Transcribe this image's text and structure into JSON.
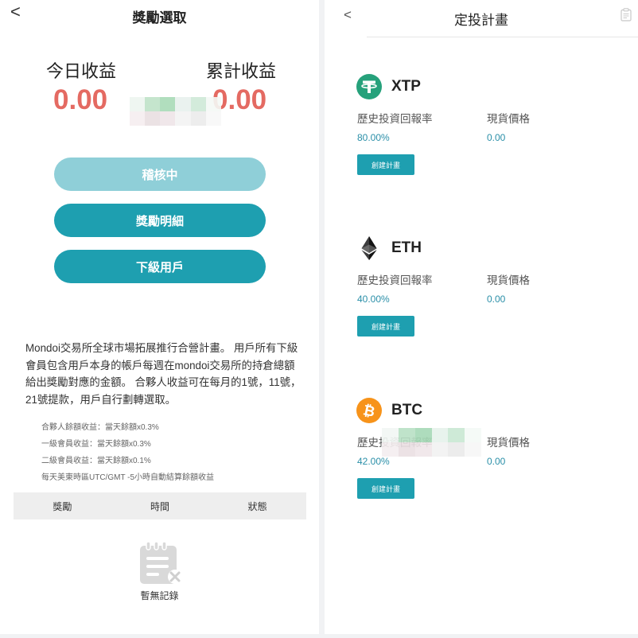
{
  "reward": {
    "title": "獎勵選取",
    "back_glyph": "<",
    "today_label": "今日收益",
    "total_label": "累計收益",
    "today_value": "0.00",
    "total_value": "0.00",
    "buttons": {
      "audit": "稽核中",
      "detail": "獎勵明細",
      "subordinate": "下級用戶"
    },
    "description": "Mondoi交易所全球市場拓展推行合營計畫。 用戶所有下級會員包含用戶本身的帳戶每週在mondoi交易所的持倉總額給出獎勵對應的金額。 合夥人收益可在每月的1號，11號，21號提款，用戶自行劃轉選取。",
    "rules": [
      "合夥人餘額收益：當天餘額x0.3%",
      "一級會員收益：當天餘額x0.3%",
      "二級會員收益：當天餘額x0.1%",
      "每天美東時區UTC/GMT -5小時自動結算餘額收益"
    ],
    "table_headers": [
      "獎勵",
      "時間",
      "狀態"
    ],
    "empty_text": "暫無記錄"
  },
  "plan": {
    "title": "定投計畫",
    "back_glyph": "<",
    "coins": [
      {
        "name": "XTP",
        "icon": "tether-icon",
        "rate_label": "歷史投資回報率",
        "price_label": "現貨價格",
        "rate": "80.00%",
        "price": "0.00",
        "button": "創建計畫",
        "color": "#26a17b"
      },
      {
        "name": "ETH",
        "icon": "ethereum-icon",
        "rate_label": "歷史投資回報率",
        "price_label": "現貨價格",
        "rate": "40.00%",
        "price": "0.00",
        "button": "創建計畫",
        "color": "#3c3c3d"
      },
      {
        "name": "BTC",
        "icon": "bitcoin-icon",
        "rate_label": "歷史投資回報率",
        "price_label": "現貨價格",
        "rate": "42.00%",
        "price": "0.00",
        "button": "創建計畫",
        "color": "#f7931a"
      }
    ]
  },
  "colors": {
    "accent": "#1e9fb0",
    "accent_light": "#8fcfd8",
    "earnings": "#e46a62",
    "value_text": "#2a8fa8"
  }
}
